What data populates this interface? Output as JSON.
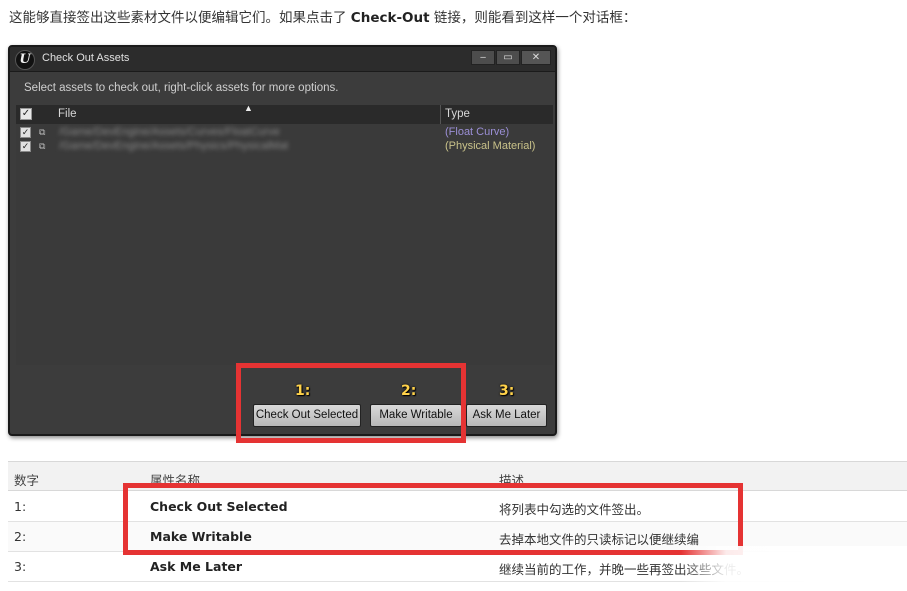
{
  "intro": {
    "before": "这能够直接签出这些素材文件以便编辑它们。如果点击了 ",
    "bold": "Check-Out",
    "after": " 链接，则能看到这样一个对话框："
  },
  "dialog": {
    "logo": "U",
    "title": "Check Out Assets",
    "window_buttons": {
      "minimize": "‒",
      "maximize": "▭",
      "close": "✕"
    },
    "instructions": "Select assets to check out, right-click assets for more options.",
    "list": {
      "columns": {
        "file": "File",
        "type": "Type"
      },
      "rows": [
        {
          "checked": "✓",
          "type": "(Float Curve)",
          "type_color": "#9b8fd6"
        },
        {
          "checked": "✓",
          "type": "(Physical Material)",
          "type_color": "#c9c28a"
        }
      ]
    },
    "step_labels": [
      "1:",
      "2:",
      "3:"
    ],
    "buttons": {
      "check_out_selected": "Check Out Selected",
      "make_writable": "Make Writable",
      "ask_me_later": "Ask Me Later"
    }
  },
  "table": {
    "headers": {
      "number": "数字",
      "property": "属性名称",
      "description": "描述"
    },
    "rows": [
      {
        "number": "1:",
        "property": "Check Out Selected",
        "description": "将列表中勾选的文件签出。"
      },
      {
        "number": "2:",
        "property": "Make Writable",
        "description": "去掉本地文件的只读标记以便继续编"
      },
      {
        "number": "3:",
        "property": "Ask Me Later",
        "description": "继续当前的工作，并晚一些再签出这些文件。"
      }
    ]
  },
  "colors": {
    "highlight": "#e53333",
    "step_label": "#ffd24a",
    "dialog_bg": "#3c3c3c"
  }
}
